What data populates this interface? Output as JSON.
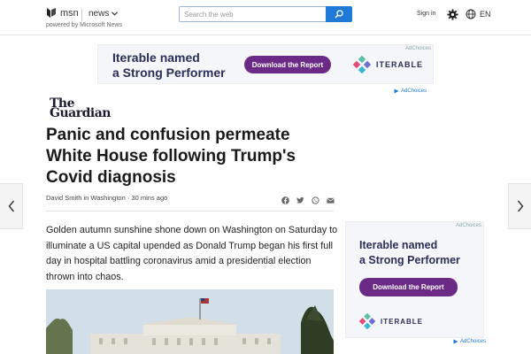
{
  "header": {
    "brand": "msn",
    "powered_by": "powered by Microsoft News",
    "section": "news",
    "search_placeholder": "Search the web",
    "sign_in": "Sign in",
    "language": "EN"
  },
  "top_ad": {
    "headline_line1": "Iterable named",
    "headline_line2": "a Strong Performer",
    "cta": "Download the Report",
    "brand": "ITERABLE",
    "ad_choices_tag": "AdChoices",
    "ad_choices_label": "AdChoices"
  },
  "article": {
    "publisher": "The Guardian",
    "publisher_line1": "The",
    "publisher_line2": "Guardian",
    "headline": "Panic and confusion permeate White House following Trump's Covid diagnosis",
    "byline": "David Smith in Washington · 30 mins ago",
    "body": "Golden autumn sunshine shone down on Washington on Saturday to illuminate a US capital upended as Donald Trump began his first full day in hospital battling coronavirus amid a presidential election thrown into chaos.",
    "share_icons": [
      "facebook-icon",
      "twitter-icon",
      "whatsapp-icon",
      "email-icon"
    ]
  },
  "side_ad": {
    "headline_line1": "Iterable named",
    "headline_line2": "a Strong Performer",
    "cta": "Download the Report",
    "brand": "ITERABLE",
    "ad_choices_tag": "AdChoices",
    "ad_choices_label": "AdChoices"
  },
  "colors": {
    "search_button": "#1e7ad6",
    "ad_cta": "#6a2a86",
    "ad_headline": "#2a2f57"
  }
}
